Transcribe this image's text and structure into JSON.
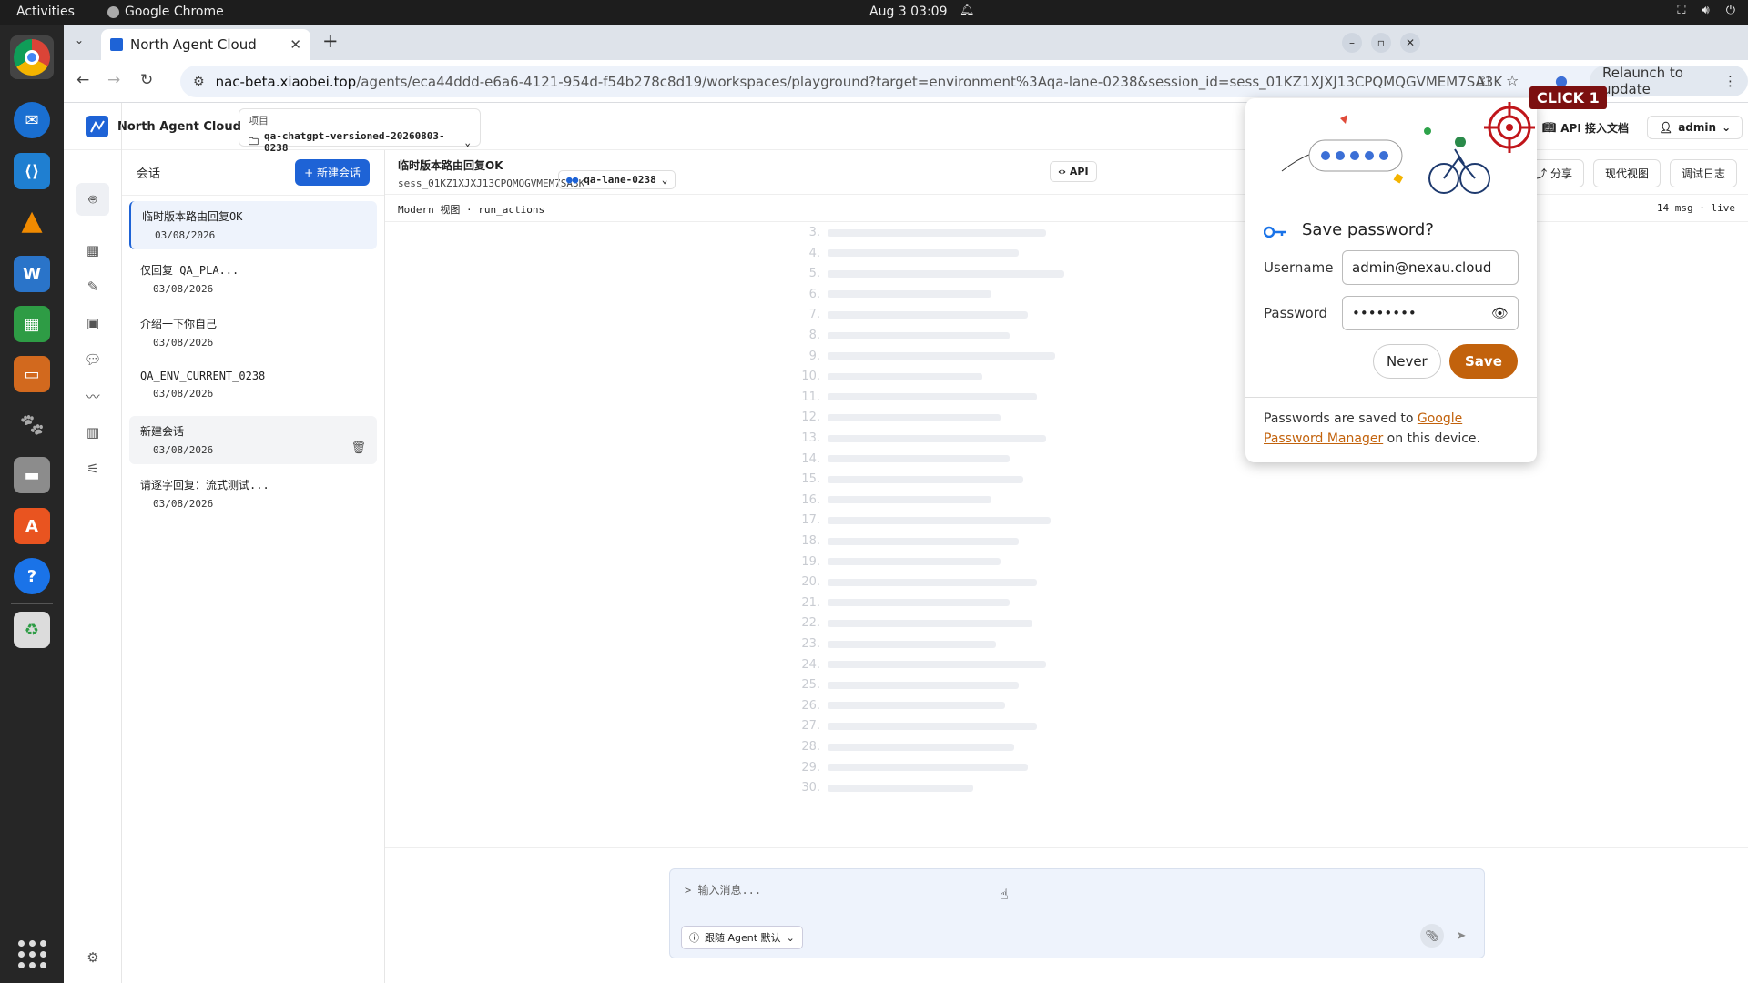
{
  "system": {
    "activities": "Activities",
    "app_name": "Google Chrome",
    "clock": "Aug 3  03:09"
  },
  "browser": {
    "tab_title": "North Agent Cloud",
    "url_host": "nac-beta.xiaobei.top",
    "url_path": "/agents/eca44ddd-e6a6-4121-954d-f54b278c8d19/workspaces/playground?target=environment%3Aqa-lane-0238&session_id=sess_01KZ1XJXJ13CPQMQGVMEM7SA3K",
    "relaunch_label": "Relaunch to update"
  },
  "app": {
    "brand": "North Agent Cloud",
    "project_label": "项目",
    "project_value": "qa-chatgpt-versioned-20260803-0238",
    "api_docs": "API 接入文档",
    "user": "admin"
  },
  "sessions": {
    "heading": "会话",
    "new_button": "+ 新建会话",
    "items": [
      {
        "name": "临时版本路由回复OK",
        "date": "03/08/2026"
      },
      {
        "name": "仅回复 QA_PLA...",
        "date": "03/08/2026"
      },
      {
        "name": "介绍一下你自己",
        "date": "03/08/2026"
      },
      {
        "name": "QA_ENV_CURRENT_0238",
        "date": "03/08/2026"
      },
      {
        "name": "新建会话",
        "date": "03/08/2026"
      },
      {
        "name": "请逐字回复：流式测试...",
        "date": "03/08/2026"
      }
    ]
  },
  "chat": {
    "title": "临时版本路由回复OK",
    "session_id": "sess_01KZ1XJXJ13CPQMQGVMEM7SA3K",
    "lane": "qa-lane-0238",
    "api_label": "API",
    "share": "分享",
    "modern_view": "现代视图",
    "debug_log": "调试日志",
    "view_mode": "Modern 视图 · run_actions",
    "stats": "14 msg · live",
    "faded_lines": [
      "3.",
      "4.",
      "5.",
      "6.",
      "7.",
      "8.",
      "9.",
      "10.",
      "11.",
      "12.",
      "13.",
      "14.",
      "15.",
      "16.",
      "17.",
      "18.",
      "19.",
      "20.",
      "21.",
      "22.",
      "23.",
      "24.",
      "25.",
      "26.",
      "27.",
      "28.",
      "29.",
      "30."
    ],
    "input_placeholder": "> 输入消息...",
    "agent_selector": "跟随 Agent 默认"
  },
  "password_bubble": {
    "title": "Save password?",
    "username_label": "Username",
    "username_value": "admin@nexau.cloud",
    "password_label": "Password",
    "password_value": "••••••••",
    "never": "Never",
    "save": "Save",
    "footer_prefix": "Passwords are saved to ",
    "footer_link": "Google Password Manager",
    "footer_suffix": " on this device."
  },
  "overlay": {
    "click_label": "CLICK 1"
  },
  "colors": {
    "accent_blue": "#1e63d6",
    "save_orange": "#c2620c",
    "click_label_bg": "#7c1010"
  }
}
